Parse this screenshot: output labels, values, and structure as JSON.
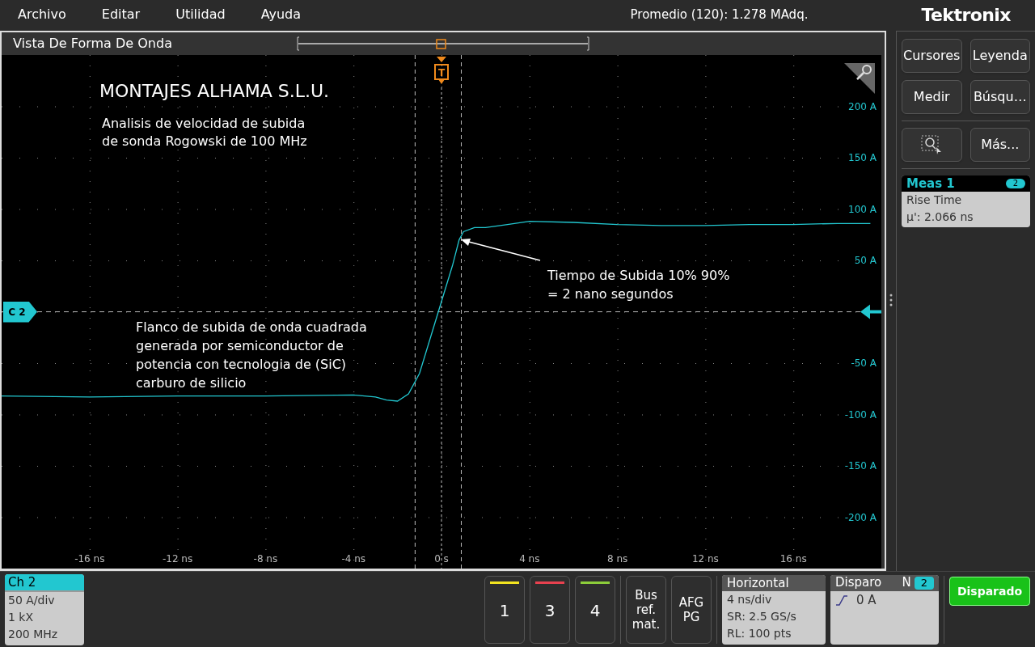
{
  "menu": [
    "Archivo",
    "Editar",
    "Utilidad",
    "Ayuda"
  ],
  "status": "Promedio (120): 1.278 MAdq.",
  "brand": "Tektronix",
  "waveform_view": {
    "title": "Vista De Forma De Onda",
    "trigger_marker": "T",
    "channel_marker": "C 2",
    "heading": "MONTAJES ALHAMA S.L.U.",
    "description": [
      "Analisis de velocidad de subida",
      "de sonda Rogowski de 100 MHz"
    ],
    "note_left": [
      "Flanco de subida de onda cuadrada",
      "generada por semiconductor de",
      "potencia con tecnologia de (SiC)",
      "carburo de silicio"
    ],
    "note_right": [
      "Tiempo de Subida 10% 90%",
      "= 2 nano segundos"
    ],
    "chart_data": {
      "type": "line",
      "xlim": [
        -20,
        20
      ],
      "ylim": [
        -250,
        250
      ],
      "xticks": [
        {
          "value": -16,
          "label": "-16 ns"
        },
        {
          "value": -12,
          "label": "-12 ns"
        },
        {
          "value": -8,
          "label": "-8 ns"
        },
        {
          "value": -4,
          "label": "-4 ns"
        },
        {
          "value": 0,
          "label": "0 s"
        },
        {
          "value": 4,
          "label": "4 ns"
        },
        {
          "value": 8,
          "label": "8 ns"
        },
        {
          "value": 12,
          "label": "12 ns"
        },
        {
          "value": 16,
          "label": "16 ns"
        }
      ],
      "yticks": [
        {
          "value": 200,
          "label": "200 A"
        },
        {
          "value": 150,
          "label": "150 A"
        },
        {
          "value": 100,
          "label": "100 A"
        },
        {
          "value": 50,
          "label": "50 A"
        },
        {
          "value": -50,
          "label": "-50 A"
        },
        {
          "value": -100,
          "label": "-100 A"
        },
        {
          "value": -150,
          "label": "-150 A"
        },
        {
          "value": -200,
          "label": "-200 A"
        }
      ],
      "x": [
        -20,
        -16,
        -12,
        -8,
        -4,
        -3,
        -2.5,
        -2,
        -1.5,
        -1,
        -0.5,
        0,
        0.5,
        0.8,
        1,
        1.5,
        2,
        3,
        4,
        6,
        8,
        10,
        12,
        14,
        16,
        18,
        19.5
      ],
      "series": [
        {
          "color": "#22c7d0",
          "values": [
            -82,
            -83,
            -82,
            -82,
            -81,
            -83,
            -86,
            -87,
            -80,
            -60,
            -25,
            10,
            45,
            70,
            78,
            82,
            82,
            85,
            88,
            87,
            85,
            84,
            84,
            85,
            85,
            86,
            86
          ]
        }
      ]
    }
  },
  "side_buttons": [
    {
      "kind": "text",
      "label": "Cursores"
    },
    {
      "kind": "text",
      "label": "Leyenda"
    },
    {
      "kind": "text",
      "label": "Medir"
    },
    {
      "kind": "text",
      "label": "Búsqu…"
    },
    {
      "kind": "icon"
    },
    {
      "kind": "text",
      "label": "Más..."
    }
  ],
  "measurement": {
    "title": "Meas 1",
    "badge": "2",
    "name": "Rise Time",
    "value": "µ': 2.066 ns"
  },
  "channel_card": {
    "title": "Ch 2",
    "lines": [
      "50 A/div",
      "1 kX",
      "200 MHz"
    ]
  },
  "channel_buttons": [
    {
      "label": "1",
      "color": "#f2e320"
    },
    {
      "label": "3",
      "color": "#e8414f"
    },
    {
      "label": "4",
      "color": "#8ccd3a"
    }
  ],
  "extra_buttons": [
    [
      "Bus",
      "ref.",
      "mat."
    ],
    [
      "AFG",
      "PG"
    ]
  ],
  "horizontal": {
    "title": "Horizontal",
    "lines": [
      "4 ns/div",
      "SR: 2.5 GS/s",
      "RL: 100 pts"
    ]
  },
  "trigger": {
    "title": "Disparo",
    "mode": "N",
    "badge": "2",
    "level": "0 A"
  },
  "trigger_status": "Disparado"
}
